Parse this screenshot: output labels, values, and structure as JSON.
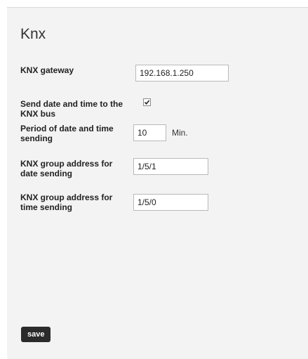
{
  "page": {
    "title": "Knx"
  },
  "form": {
    "gateway_label": "KNX gateway",
    "gateway_value": "192.168.1.250",
    "send_datetime_label": "Send date and time to the KNX bus",
    "send_datetime_checked": true,
    "period_label": "Period of date and time sending",
    "period_value": "10",
    "period_unit": "Min.",
    "date_address_label": "KNX group address for date sending",
    "date_address_value": "1/5/1",
    "time_address_label": "KNX group address for time sending",
    "time_address_value": "1/5/0"
  },
  "actions": {
    "save_label": "save"
  }
}
